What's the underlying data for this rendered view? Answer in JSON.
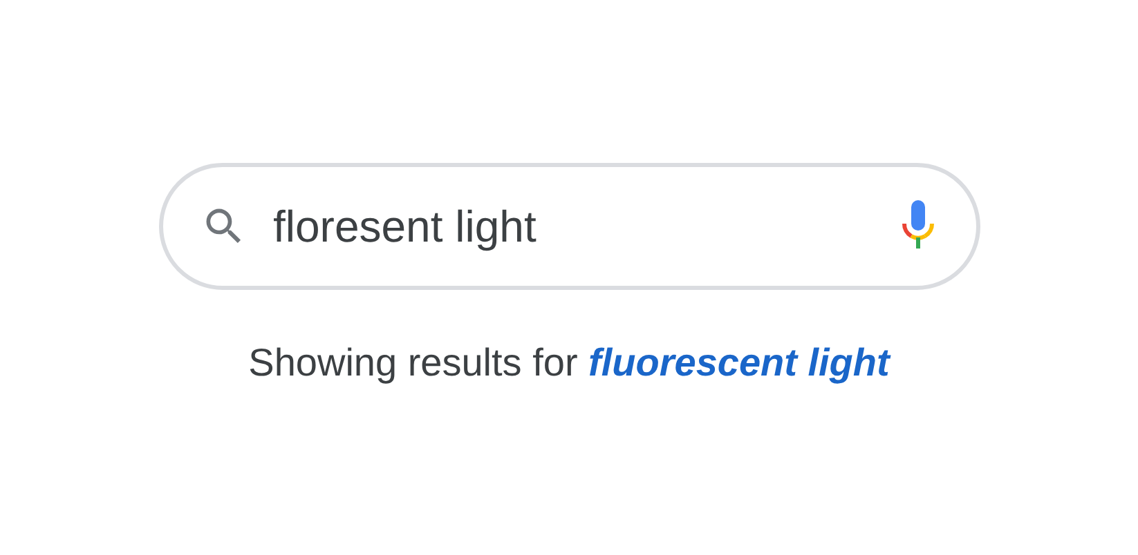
{
  "search": {
    "value": "floresent light"
  },
  "correction": {
    "prefix": "Showing results for",
    "link": "fluorescent light"
  }
}
